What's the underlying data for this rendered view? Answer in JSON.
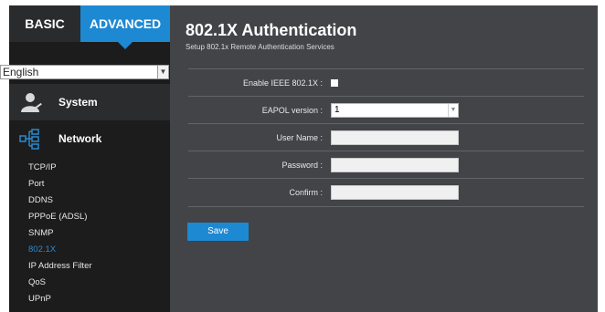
{
  "tabs": {
    "basic": "BASIC",
    "advanced": "ADVANCED"
  },
  "language": {
    "selected": "English"
  },
  "menu": {
    "system": "System",
    "network": "Network",
    "items": [
      "TCP/IP",
      "Port",
      "DDNS",
      "PPPoE (ADSL)",
      "SNMP",
      "802.1X",
      "IP Address Filter",
      "QoS",
      "UPnP"
    ],
    "active_index": 5
  },
  "page": {
    "title": "802.1X Authentication",
    "subtitle": "Setup 802.1x Remote Authentication Services"
  },
  "form": {
    "enable_label": "Enable IEEE 802.1X :",
    "eapol_label": "EAPOL version :",
    "eapol_value": "1",
    "username_label": "User Name :",
    "password_label": "Password :",
    "confirm_label": "Confirm :"
  },
  "buttons": {
    "save": "Save"
  },
  "colors": {
    "accent": "#1d89d3",
    "sidebar": "#1c1c1d",
    "panel": "#424447"
  }
}
